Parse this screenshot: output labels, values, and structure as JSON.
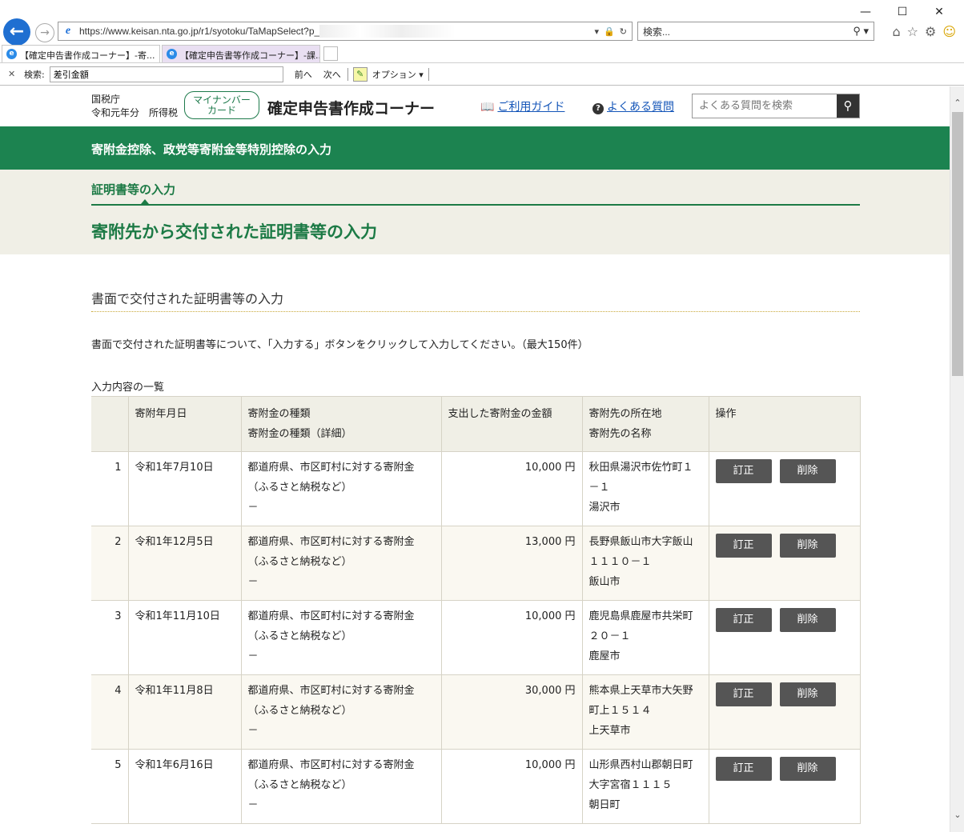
{
  "browser": {
    "url": "https://www.keisan.nta.go.jp/r1/syotoku/TaMapSelect?p_se",
    "search_placeholder": "検索...",
    "tabs": [
      {
        "label": "【確定申告書作成コーナー】-寄..."
      },
      {
        "label": "【確定申告書等作成コーナー】-課..."
      }
    ],
    "find": {
      "label": "検索:",
      "value": "差引金額",
      "prev": "前へ",
      "next": "次へ",
      "options": "オプション"
    }
  },
  "header": {
    "agency_line1": "国税庁",
    "agency_line2": "令和元年分　所得税",
    "mynumber_line1": "マイナンバー",
    "mynumber_line2": "カード",
    "site_title": "確定申告書作成コーナー",
    "guide_link": "ご利用ガイド",
    "faq_link": "よくある質問",
    "faq_search_placeholder": "よくある質問を検索"
  },
  "greenbar_title": "寄附金控除、政党等寄附金等特別控除の入力",
  "step_label": "証明書等の入力",
  "page_title": "寄附先から交付された証明書等の入力",
  "section_title": "書面で交付された証明書等の入力",
  "description": "書面で交付された証明書等について、「入力する」ボタンをクリックして入力してください。（最大150件）",
  "list_caption": "入力内容の一覧",
  "table": {
    "headers": {
      "date": "寄附年月日",
      "kind1": "寄附金の種類",
      "kind2": "寄附金の種類（詳細）",
      "amount": "支出した寄附金の金額",
      "addr1": "寄附先の所在地",
      "addr2": "寄附先の名称",
      "ops": "操作"
    },
    "rows": [
      {
        "no": "1",
        "date": "令和1年7月10日",
        "kind": "都道府県、市区町村に対する寄附金",
        "kind_note": "（ふるさと納税など）",
        "detail": "－",
        "amount": "10,000 円",
        "addr_a": "秋田県湯沢市佐竹町１",
        "addr_b": "－１",
        "name": "湯沢市"
      },
      {
        "no": "2",
        "date": "令和1年12月5日",
        "kind": "都道府県、市区町村に対する寄附金",
        "kind_note": "（ふるさと納税など）",
        "detail": "－",
        "amount": "13,000 円",
        "addr_a": "長野県飯山市大字飯山",
        "addr_b": "１１１０－１",
        "name": "飯山市"
      },
      {
        "no": "3",
        "date": "令和1年11月10日",
        "kind": "都道府県、市区町村に対する寄附金",
        "kind_note": "（ふるさと納税など）",
        "detail": "－",
        "amount": "10,000 円",
        "addr_a": "鹿児島県鹿屋市共栄町",
        "addr_b": "２０－１",
        "name": "鹿屋市"
      },
      {
        "no": "4",
        "date": "令和1年11月8日",
        "kind": "都道府県、市区町村に対する寄附金",
        "kind_note": "（ふるさと納税など）",
        "detail": "－",
        "amount": "30,000 円",
        "addr_a": "熊本県上天草市大矢野",
        "addr_b": "町上１５１４",
        "name": "上天草市"
      },
      {
        "no": "5",
        "date": "令和1年6月16日",
        "kind": "都道府県、市区町村に対する寄附金",
        "kind_note": "（ふるさと納税など）",
        "detail": "－",
        "amount": "10,000 円",
        "addr_a": "山形県西村山郡朝日町",
        "addr_b": "大字宮宿１１１５",
        "name": "朝日町"
      }
    ],
    "edit_label": "訂正",
    "delete_label": "削除"
  },
  "colors": {
    "brand_green": "#1c8350",
    "title_green": "#1c7a45",
    "beige": "#f0efe6",
    "button_gray": "#555555"
  }
}
